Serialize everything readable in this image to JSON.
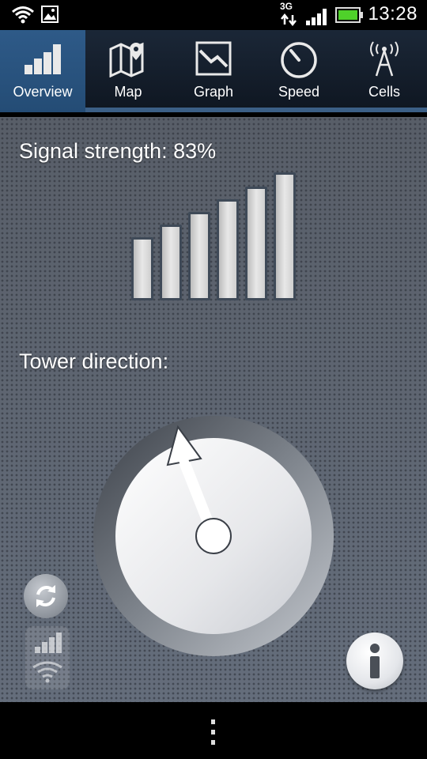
{
  "status_bar": {
    "time": "13:28",
    "network_type": "3G",
    "icons": [
      "wifi-icon",
      "gallery-notification-icon",
      "data-arrows-icon",
      "cell-signal-icon",
      "battery-icon"
    ]
  },
  "tabs": [
    {
      "label": "Overview",
      "icon": "signal-bars-icon",
      "active": true
    },
    {
      "label": "Map",
      "icon": "map-icon",
      "active": false
    },
    {
      "label": "Graph",
      "icon": "graph-icon",
      "active": false
    },
    {
      "label": "Speed",
      "icon": "speedometer-icon",
      "active": false
    },
    {
      "label": "Cells",
      "icon": "cell-tower-icon",
      "active": false
    }
  ],
  "overview": {
    "signal_label": "Signal strength: 83%",
    "signal_strength_percent": 83,
    "bars_count": 6,
    "tower_label": "Tower direction:",
    "tower_direction_deg": -20
  },
  "controls": {
    "refresh_icon": "refresh-icon",
    "signal_wifi_icon": "signal-wifi-toggle-icon",
    "info_icon": "info-icon"
  },
  "nav": {
    "menu_icon": "overflow-menu-icon"
  },
  "colors": {
    "tab_active": "#2e5a88",
    "tab_bar": "#1b2737",
    "tab_underline": "#3b5f86",
    "background": "#5b6370",
    "bar_border": "#3f4a58"
  }
}
